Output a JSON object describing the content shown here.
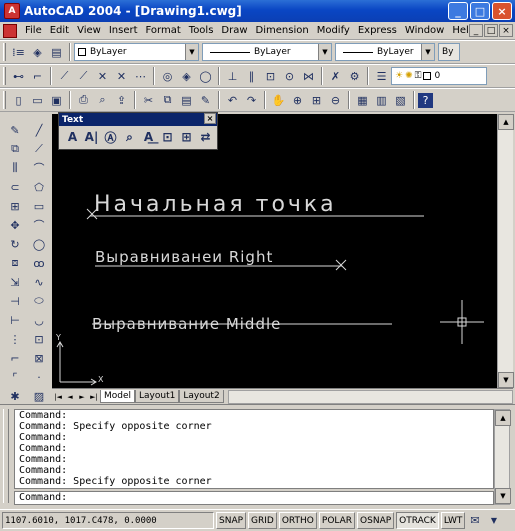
{
  "window": {
    "title": "AutoCAD 2004 - [Drawing1.cwg]",
    "app_icon": "autocad-logo-icon",
    "controls": [
      "_",
      "□",
      "×"
    ]
  },
  "menu": {
    "items": [
      "File",
      "Edit",
      "View",
      "Insert",
      "Format",
      "Tools",
      "Draw",
      "Dimension",
      "Modify",
      "Express",
      "Window",
      "Help"
    ],
    "mdi_controls": [
      "_",
      "□",
      "×"
    ]
  },
  "properties_bar": {
    "layer_value": "ByLayer",
    "linetype_value": "ByLayer",
    "lineweight_value": "ByLayer",
    "plotstyle_value": "By"
  },
  "layers_bar": {
    "current_layer": "0"
  },
  "text_toolbar": {
    "title": "Text",
    "close": "×"
  },
  "drawing": {
    "background": "#000000",
    "text_color": "#d9d9d9",
    "texts": {
      "start_point": "Начальная точка",
      "align_right": "Выравниванеи Right",
      "align_middle": "Выравнивание Middle"
    },
    "ucs": {
      "x_label": "X",
      "y_label": "Y"
    }
  },
  "tabs": {
    "nav": [
      "|◄",
      "◄",
      "►",
      "►|"
    ],
    "items": [
      "Model",
      "Layout1",
      "Layout2"
    ],
    "active": "Model"
  },
  "command": {
    "log": [
      "Command:",
      "Command: Specify opposite corner",
      "Command:",
      "Command:",
      "Command:",
      "Command:",
      "Command: Specify opposite corner"
    ],
    "prompt": "Command:"
  },
  "status": {
    "coords": "1107.6010, 1017.C478, 0.0000",
    "toggles": [
      {
        "label": "SNAP",
        "on": false
      },
      {
        "label": "GRID",
        "on": false
      },
      {
        "label": "ORTHO",
        "on": false
      },
      {
        "label": "POLAR",
        "on": false
      },
      {
        "label": "OSNAP",
        "on": false
      },
      {
        "label": "OTRACK",
        "on": true
      },
      {
        "label": "LWT",
        "on": false
      }
    ]
  }
}
